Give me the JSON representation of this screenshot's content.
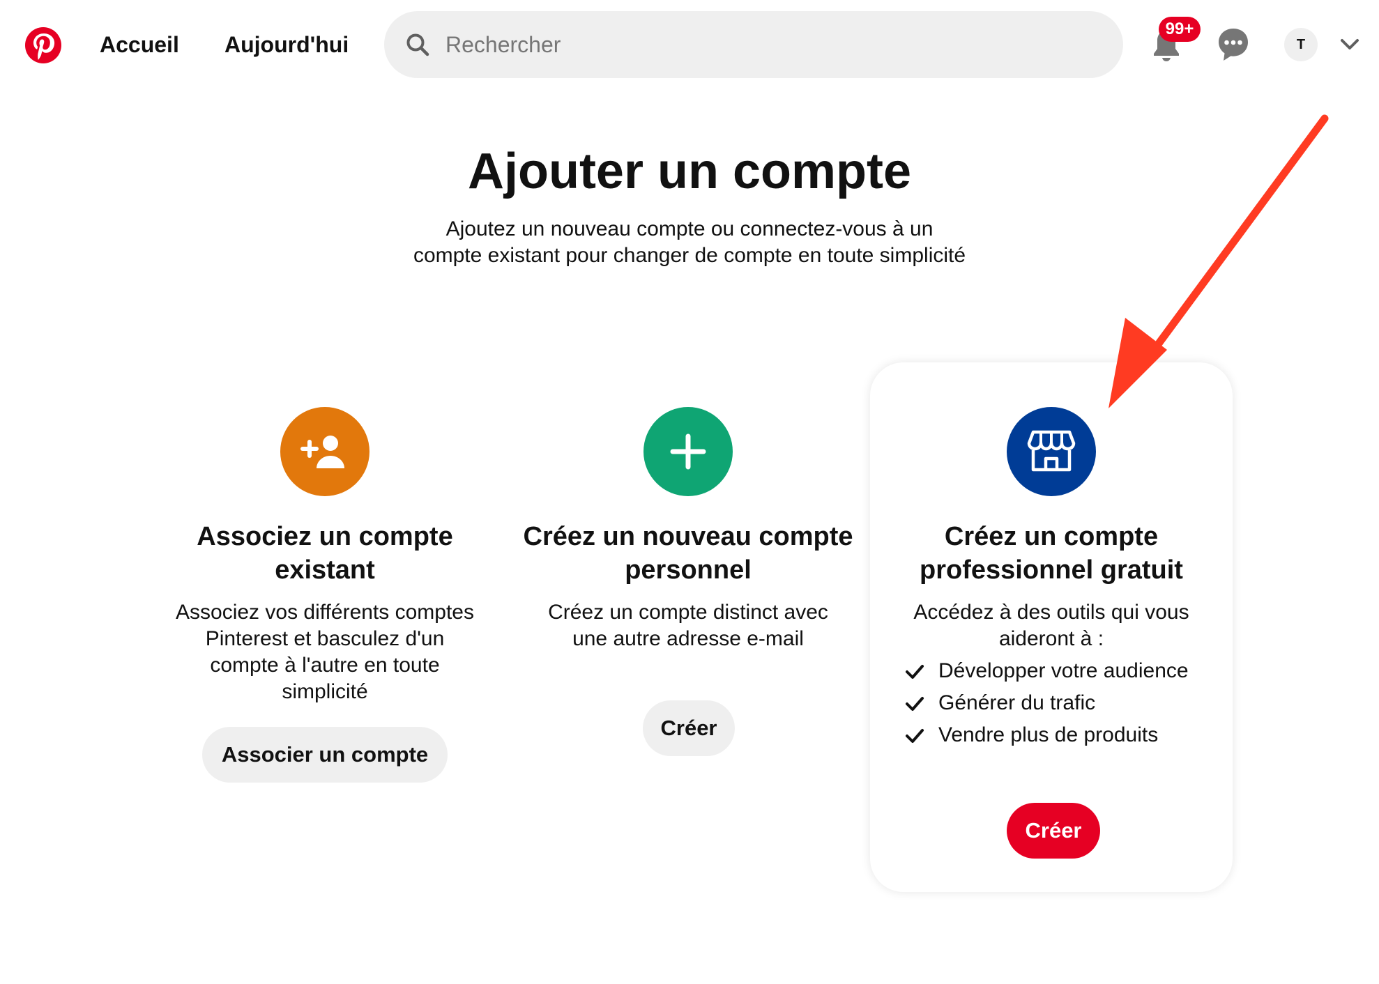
{
  "header": {
    "nav": {
      "home": "Accueil",
      "today": "Aujourd'hui"
    },
    "search": {
      "placeholder": "Rechercher"
    },
    "notifications": {
      "badge": "99+"
    },
    "avatar": {
      "initial": "T"
    }
  },
  "page": {
    "title": "Ajouter un compte",
    "subtitle": "Ajoutez un nouveau compte ou connectez-vous à un compte existant pour changer de compte en toute simplicité"
  },
  "cards": {
    "associate": {
      "title": "Associez un compte existant",
      "description": "Associez vos différents comptes Pinterest et basculez d'un compte à l'autre en toute simplicité",
      "button": "Associer un compte",
      "icon": "add-person-icon",
      "color": "#e2780c"
    },
    "personal": {
      "title": "Créez un nouveau compte personnel",
      "description": "Créez un compte distinct avec une autre adresse e-mail",
      "button": "Créer",
      "icon": "plus-icon",
      "color": "#0fa573"
    },
    "business": {
      "title": "Créez un compte professionnel gratuit",
      "description": "Accédez à des outils qui vous aideront à :",
      "benefits": [
        "Développer votre audience",
        "Générer du trafic",
        "Vendre plus de produits"
      ],
      "button": "Créer",
      "icon": "storefront-icon",
      "color": "#003c96"
    }
  },
  "colors": {
    "brand_red": "#e60023",
    "annotation_arrow": "#ff3b22"
  }
}
